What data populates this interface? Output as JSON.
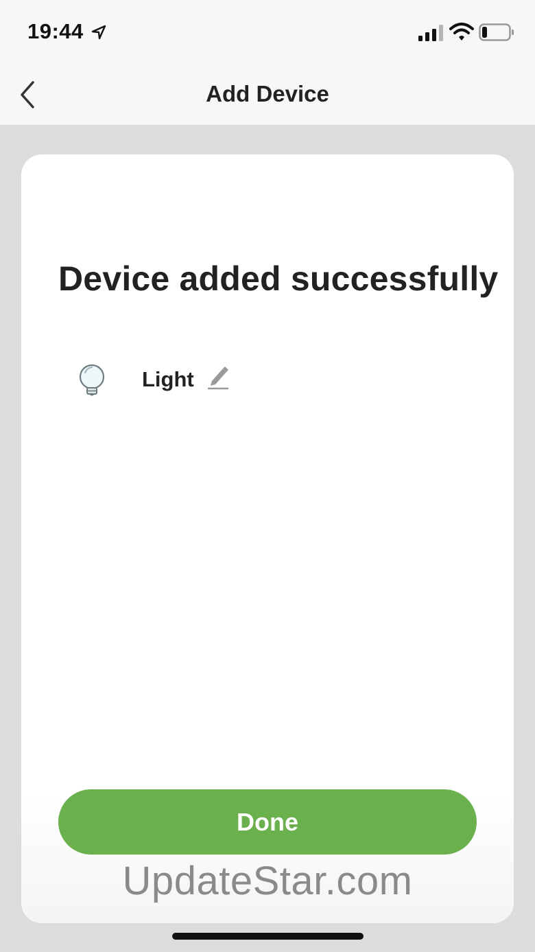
{
  "status_bar": {
    "time": "19:44",
    "location_icon": "location-arrow-icon",
    "signal_icon": "cellular-signal-icon",
    "wifi_icon": "wifi-icon",
    "battery_icon": "battery-icon",
    "battery_level": 0.2
  },
  "nav": {
    "title": "Add Device",
    "back_icon": "chevron-left-icon"
  },
  "main": {
    "headline": "Device added successfully",
    "device": {
      "icon": "light-bulb-icon",
      "name": "Light",
      "edit_icon": "pencil-icon"
    },
    "done_label": "Done"
  },
  "watermark": "UpdateStar.com",
  "colors": {
    "accent": "#6ab04c",
    "background": "#dcdcdc",
    "card": "#ffffff",
    "text": "#222222"
  }
}
